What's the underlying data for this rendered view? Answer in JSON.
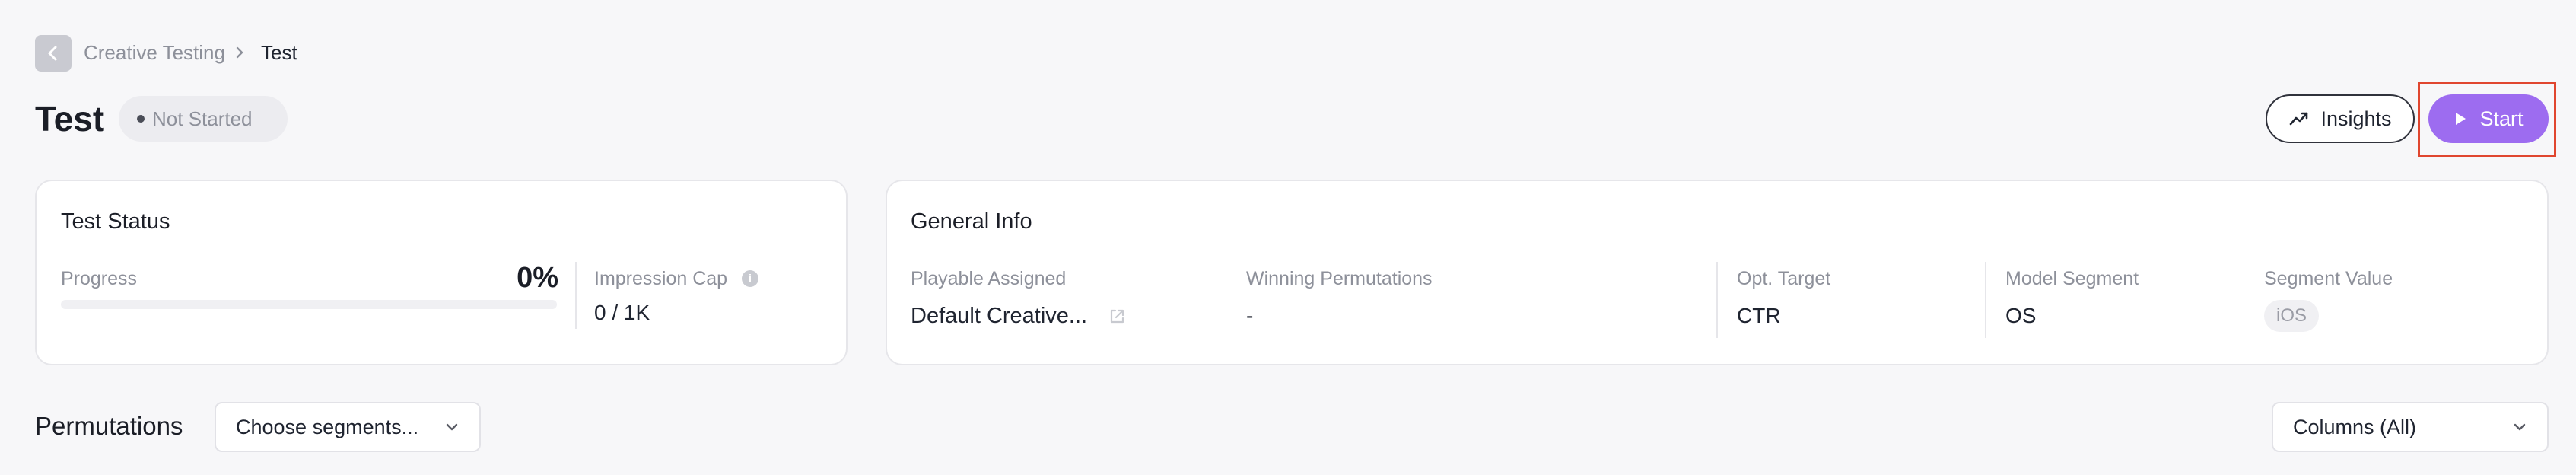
{
  "breadcrumb": {
    "parent": "Creative Testing",
    "current": "Test"
  },
  "header": {
    "title": "Test",
    "status": "Not Started",
    "insights_label": "Insights",
    "start_label": "Start"
  },
  "test_status": {
    "title": "Test Status",
    "progress_label": "Progress",
    "progress_value": "0%",
    "progress_fraction": 0,
    "impression_cap_label": "Impression Cap",
    "impression_cap_value": "0 / 1K"
  },
  "general_info": {
    "title": "General Info",
    "playable_label": "Playable Assigned",
    "playable_value": "Default Creative...",
    "winning_label": "Winning Permutations",
    "winning_value": "-",
    "opt_target_label": "Opt. Target",
    "opt_target_value": "CTR",
    "model_segment_label": "Model Segment",
    "model_segment_value": "OS",
    "segment_value_label": "Segment Value",
    "segment_value_value": "iOS"
  },
  "permutations": {
    "title": "Permutations",
    "segments_placeholder": "Choose segments...",
    "columns_value": "Columns (All)"
  },
  "colors": {
    "accent": "#9d6cf0",
    "highlight": "#e0462f"
  }
}
